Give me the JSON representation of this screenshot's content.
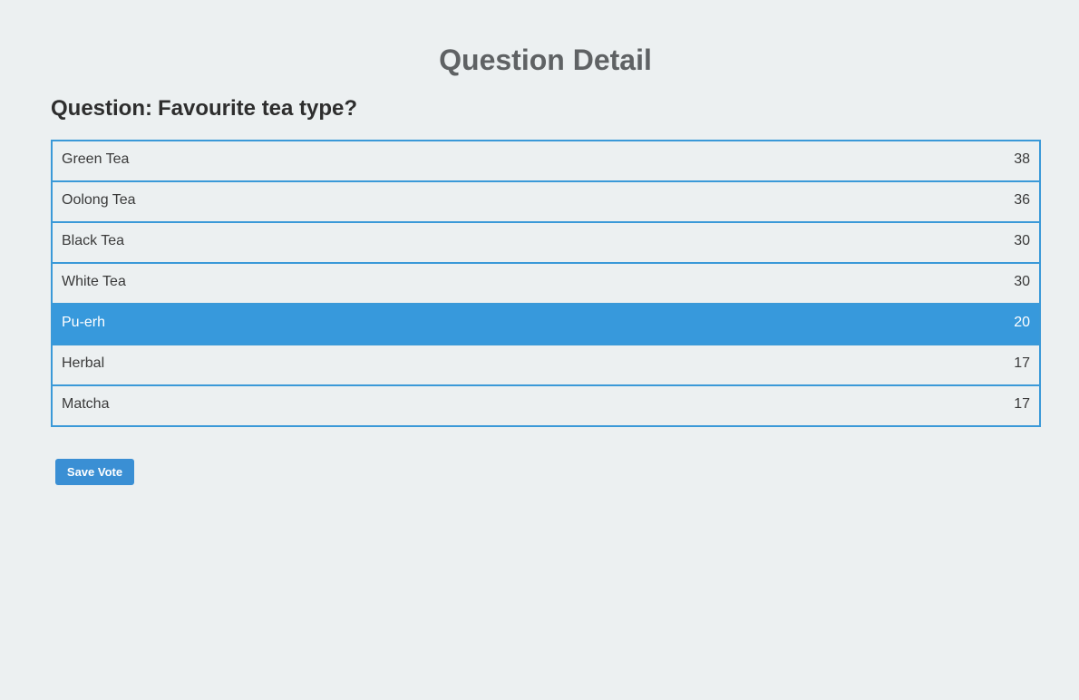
{
  "page": {
    "title": "Question Detail"
  },
  "question": {
    "label": "Question:",
    "text": "Favourite tea type?"
  },
  "choices": [
    {
      "label": "Green Tea",
      "votes": "38",
      "selected": false
    },
    {
      "label": "Oolong Tea",
      "votes": "36",
      "selected": false
    },
    {
      "label": "Black Tea",
      "votes": "30",
      "selected": false
    },
    {
      "label": "White Tea",
      "votes": "30",
      "selected": false
    },
    {
      "label": "Pu-erh",
      "votes": "20",
      "selected": true
    },
    {
      "label": "Herbal",
      "votes": "17",
      "selected": false
    },
    {
      "label": "Matcha",
      "votes": "17",
      "selected": false
    }
  ],
  "actions": {
    "save_label": "Save Vote"
  },
  "colors": {
    "background": "#ecf0f1",
    "accent": "#3799dc",
    "button": "#3a8fd4",
    "title": "#5f6264"
  }
}
